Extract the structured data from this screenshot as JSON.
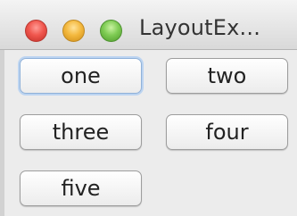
{
  "window": {
    "title": "LayoutEx...",
    "traffic_lights": {
      "close": {
        "icon": "close-icon",
        "color": "#f0574e"
      },
      "minimize": {
        "icon": "minimize-icon",
        "color": "#f4b93f"
      },
      "zoom": {
        "icon": "zoom-icon",
        "color": "#7fcc54"
      }
    }
  },
  "buttons": {
    "one": "one",
    "two": "two",
    "three": "three",
    "four": "four",
    "five": "five"
  },
  "focused_button": "one"
}
